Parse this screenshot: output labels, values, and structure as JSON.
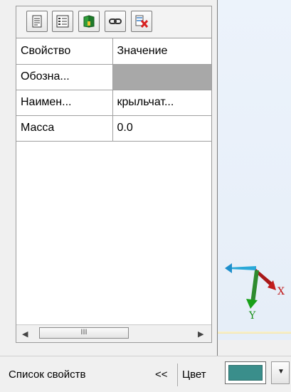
{
  "toolbar": {
    "buttons": [
      "properties-doc-icon",
      "list-icon",
      "book-icon",
      "link-icon",
      "delete-icon"
    ]
  },
  "table": {
    "headers": [
      "Свойство",
      "Значение"
    ],
    "rows": [
      {
        "name": "Обозна...",
        "value": ""
      },
      {
        "name": "Наимен...",
        "value": "крыльчат..."
      },
      {
        "name": "Масса",
        "value": "0.0"
      }
    ]
  },
  "scrollbar": {
    "left_arrow": "◀",
    "right_arrow": "▶",
    "thumb_grip": "III"
  },
  "axes": {
    "x_label": "X",
    "y_label": "Y"
  },
  "status": {
    "panel_label": "Список свойств",
    "collapse": "<<",
    "color_label": "Цвет",
    "color_value": "#3a8e8b"
  }
}
